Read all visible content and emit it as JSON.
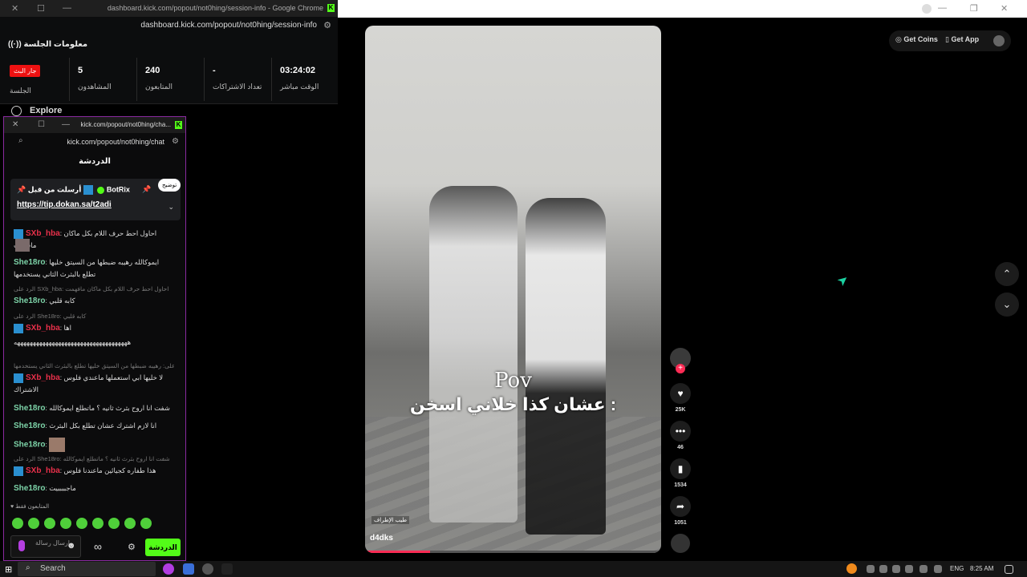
{
  "browser_bg": {
    "controls": [
      "—",
      "❐",
      "✕"
    ]
  },
  "session_window": {
    "title": "dashboard.kick.com/popout/not0hing/session-info - Google Chrome",
    "url": "dashboard.kick.com/popout/not0hing/session-info",
    "header": "معلومات الجلسة",
    "live_badge": "جار البث",
    "live_label": "الجلسة",
    "stats": [
      {
        "value": "5",
        "label": "المشاهدون"
      },
      {
        "value": "240",
        "label": "المتابعون"
      },
      {
        "value": "-",
        "label": "تعداد الاشتراكات"
      },
      {
        "value": "03:24:02",
        "label": "الوقت مباشر"
      }
    ]
  },
  "explore_label": "Explore",
  "chat_window": {
    "title": "kick.com/popout/not0hing/cha...",
    "url": "kick.com/popout/not0hing/chat",
    "heading": "الدردشة",
    "pinned": {
      "pinned_by": "أرسلت من قبل",
      "user": "BotRix",
      "link": "https://tip.dokan.sa/t2adi",
      "bubble": "توضيح"
    },
    "messages": [
      {
        "user": "SXb_hba",
        "color": "red",
        "text": "احاول احط حرف اللام بكل ماكان مافهمت"
      },
      {
        "user": "She18ro",
        "color": "green",
        "text": "ايموكالله رهيبه ضبطها من السيتق خليها تطلع بالبثرث الثاني يستخدمها"
      },
      {
        "reply": "الرد على SXb_hba: احاول احط حرف اللام بكل ماكان مافهمت"
      },
      {
        "user": "She18ro",
        "color": "green",
        "text": "كابه قلبي"
      },
      {
        "reply": "الرد على She18ro: كابه قلبي"
      },
      {
        "user": "SXb_hba",
        "color": "red",
        "text": "اها"
      },
      {
        "text": "ههههههههههههههههههههههههههههههههههههه"
      },
      {
        "reply": "الرد على: رهيبه ضبطها من السيتق خليها تطلع بالبثرث الثاني يستخدمها"
      },
      {
        "user": "SXb_hba",
        "color": "red",
        "text": "لا خليها ابي استعملها ماعندي فلوس الاشتراك"
      },
      {
        "user": "She18ro",
        "color": "green",
        "text": "شفت انا اروح بثرث ثانيه ؟ ماتطلع ايموكالله"
      },
      {
        "user": "She18ro",
        "color": "green",
        "text": "انا لازم اشترك عشان تطلع بكل البثرث"
      },
      {
        "user": "She18ro",
        "color": "green",
        "text": ""
      },
      {
        "reply": "الرد على She18ro: شفت انا اروح بثرث ثانيه ؟ ماتطلع ايموكالله"
      },
      {
        "user": "SXb_hba",
        "color": "red",
        "text": "هذا طفاره كجيائين ماعندنا فلوس"
      },
      {
        "user": "She18ro",
        "color": "green",
        "text": "ماجببببيت"
      }
    ],
    "followers_only": "المتابعون فقط",
    "input_placeholder": "إرسال رسالة",
    "send_label": "الدردشة"
  },
  "tiktok": {
    "get_coins": "Get Coins",
    "get_app": "Get App",
    "caption_line1": "Pov",
    "caption_line2": "عشان كذا خلاني اسخن :",
    "video_tag": "طيب الإطراف",
    "author": "d4dks",
    "progress_fraction": 0.22,
    "likes": "25K",
    "comments": "46",
    "saves": "1534",
    "shares": "1051"
  },
  "taskbar": {
    "search": "Search",
    "lang": "ENG",
    "time": "8:25 AM"
  },
  "colors": {
    "kick_green": "#53fc18",
    "tiktok_red": "#fe2c55",
    "live_red": "#e11111"
  }
}
